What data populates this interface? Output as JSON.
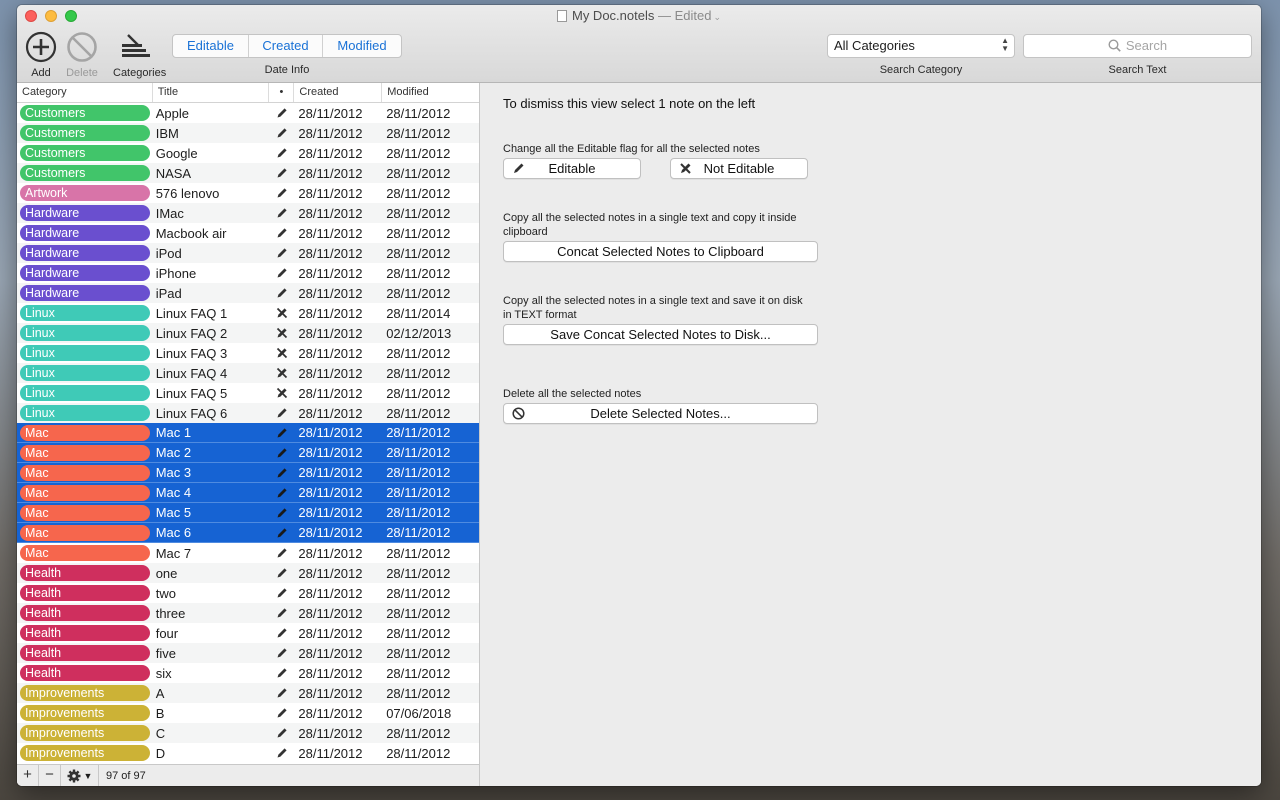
{
  "window": {
    "doc_title": "My Doc.notels",
    "edited_label": "— Edited"
  },
  "toolbar": {
    "add_label": "Add",
    "delete_label": "Delete",
    "categories_label": "Categories",
    "segments": [
      "Editable",
      "Created",
      "Modified"
    ],
    "date_info_label": "Date Info",
    "category_select_value": "All Categories",
    "search_category_label": "Search Category",
    "search_placeholder": "Search",
    "search_text_label": "Search Text"
  },
  "table": {
    "headers": {
      "category": "Category",
      "title": "Title",
      "editable": "•",
      "created": "Created",
      "modified": "Modified"
    },
    "rows": [
      {
        "category": "Customers",
        "title": "Apple",
        "icon": "pencil",
        "created": "28/11/2012",
        "modified": "28/11/2012",
        "selected": false
      },
      {
        "category": "Customers",
        "title": "IBM",
        "icon": "pencil",
        "created": "28/11/2012",
        "modified": "28/11/2012",
        "selected": false
      },
      {
        "category": "Customers",
        "title": "Google",
        "icon": "pencil",
        "created": "28/11/2012",
        "modified": "28/11/2012",
        "selected": false
      },
      {
        "category": "Customers",
        "title": "NASA",
        "icon": "pencil",
        "created": "28/11/2012",
        "modified": "28/11/2012",
        "selected": false
      },
      {
        "category": "Artwork",
        "title": "576 lenovo",
        "icon": "pencil",
        "created": "28/11/2012",
        "modified": "28/11/2012",
        "selected": false
      },
      {
        "category": "Hardware",
        "title": "IMac",
        "icon": "pencil",
        "created": "28/11/2012",
        "modified": "28/11/2012",
        "selected": false
      },
      {
        "category": "Hardware",
        "title": "Macbook air",
        "icon": "pencil",
        "created": "28/11/2012",
        "modified": "28/11/2012",
        "selected": false
      },
      {
        "category": "Hardware",
        "title": "iPod",
        "icon": "pencil",
        "created": "28/11/2012",
        "modified": "28/11/2012",
        "selected": false
      },
      {
        "category": "Hardware",
        "title": "iPhone",
        "icon": "pencil",
        "created": "28/11/2012",
        "modified": "28/11/2012",
        "selected": false
      },
      {
        "category": "Hardware",
        "title": "iPad",
        "icon": "pencil",
        "created": "28/11/2012",
        "modified": "28/11/2012",
        "selected": false
      },
      {
        "category": "Linux",
        "title": "Linux FAQ 1",
        "icon": "crossed",
        "created": "28/11/2012",
        "modified": "28/11/2014",
        "selected": false
      },
      {
        "category": "Linux",
        "title": "Linux FAQ 2",
        "icon": "crossed",
        "created": "28/11/2012",
        "modified": "02/12/2013",
        "selected": false
      },
      {
        "category": "Linux",
        "title": "Linux FAQ 3",
        "icon": "crossed",
        "created": "28/11/2012",
        "modified": "28/11/2012",
        "selected": false
      },
      {
        "category": "Linux",
        "title": "Linux FAQ 4",
        "icon": "crossed",
        "created": "28/11/2012",
        "modified": "28/11/2012",
        "selected": false
      },
      {
        "category": "Linux",
        "title": "Linux FAQ 5",
        "icon": "crossed",
        "created": "28/11/2012",
        "modified": "28/11/2012",
        "selected": false
      },
      {
        "category": "Linux",
        "title": "Linux FAQ 6",
        "icon": "pencil",
        "created": "28/11/2012",
        "modified": "28/11/2012",
        "selected": false
      },
      {
        "category": "Mac",
        "title": "Mac 1",
        "icon": "pencil",
        "created": "28/11/2012",
        "modified": "28/11/2012",
        "selected": true
      },
      {
        "category": "Mac",
        "title": "Mac 2",
        "icon": "pencil",
        "created": "28/11/2012",
        "modified": "28/11/2012",
        "selected": true
      },
      {
        "category": "Mac",
        "title": "Mac 3",
        "icon": "pencil",
        "created": "28/11/2012",
        "modified": "28/11/2012",
        "selected": true
      },
      {
        "category": "Mac",
        "title": "Mac 4",
        "icon": "pencil",
        "created": "28/11/2012",
        "modified": "28/11/2012",
        "selected": true
      },
      {
        "category": "Mac",
        "title": "Mac 5",
        "icon": "pencil",
        "created": "28/11/2012",
        "modified": "28/11/2012",
        "selected": true
      },
      {
        "category": "Mac",
        "title": "Mac 6",
        "icon": "pencil",
        "created": "28/11/2012",
        "modified": "28/11/2012",
        "selected": true
      },
      {
        "category": "Mac",
        "title": "Mac 7",
        "icon": "pencil",
        "created": "28/11/2012",
        "modified": "28/11/2012",
        "selected": false
      },
      {
        "category": "Health",
        "title": "one",
        "icon": "pencil",
        "created": "28/11/2012",
        "modified": "28/11/2012",
        "selected": false
      },
      {
        "category": "Health",
        "title": "two",
        "icon": "pencil",
        "created": "28/11/2012",
        "modified": "28/11/2012",
        "selected": false
      },
      {
        "category": "Health",
        "title": "three",
        "icon": "pencil",
        "created": "28/11/2012",
        "modified": "28/11/2012",
        "selected": false
      },
      {
        "category": "Health",
        "title": "four",
        "icon": "pencil",
        "created": "28/11/2012",
        "modified": "28/11/2012",
        "selected": false
      },
      {
        "category": "Health",
        "title": "five",
        "icon": "pencil",
        "created": "28/11/2012",
        "modified": "28/11/2012",
        "selected": false
      },
      {
        "category": "Health",
        "title": "six",
        "icon": "pencil",
        "created": "28/11/2012",
        "modified": "28/11/2012",
        "selected": false
      },
      {
        "category": "Improvements",
        "title": "A",
        "icon": "pencil",
        "created": "28/11/2012",
        "modified": "28/11/2012",
        "selected": false
      },
      {
        "category": "Improvements",
        "title": "B",
        "icon": "pencil",
        "created": "28/11/2012",
        "modified": "07/06/2018",
        "selected": false
      },
      {
        "category": "Improvements",
        "title": "C",
        "icon": "pencil",
        "created": "28/11/2012",
        "modified": "28/11/2012",
        "selected": false
      },
      {
        "category": "Improvements",
        "title": "D",
        "icon": "pencil",
        "created": "28/11/2012",
        "modified": "28/11/2012",
        "selected": false
      }
    ],
    "count_label": "97 of 97"
  },
  "category_colors": {
    "Customers": "#41c56a",
    "Artwork": "#d874a8",
    "Hardware": "#6a4fcf",
    "Linux": "#3fcab7",
    "Mac": "#f6664d",
    "Health": "#cf2f5e",
    "Improvements": "#ccb236"
  },
  "detail": {
    "heading": "To dismiss this view select 1 note on the left",
    "editable_text": "Change all the Editable flag for all the selected notes",
    "editable_button": "Editable",
    "not_editable_button": "Not Editable",
    "concat_text": "Copy all the selected notes in a single text and copy it inside clipboard",
    "concat_button": "Concat Selected Notes to Clipboard",
    "save_text": "Copy all the selected notes in a single text and save it on disk in TEXT format",
    "save_button": "Save Concat Selected Notes to Disk...",
    "delete_text": "Delete all the selected notes",
    "delete_button": "Delete Selected Notes..."
  }
}
